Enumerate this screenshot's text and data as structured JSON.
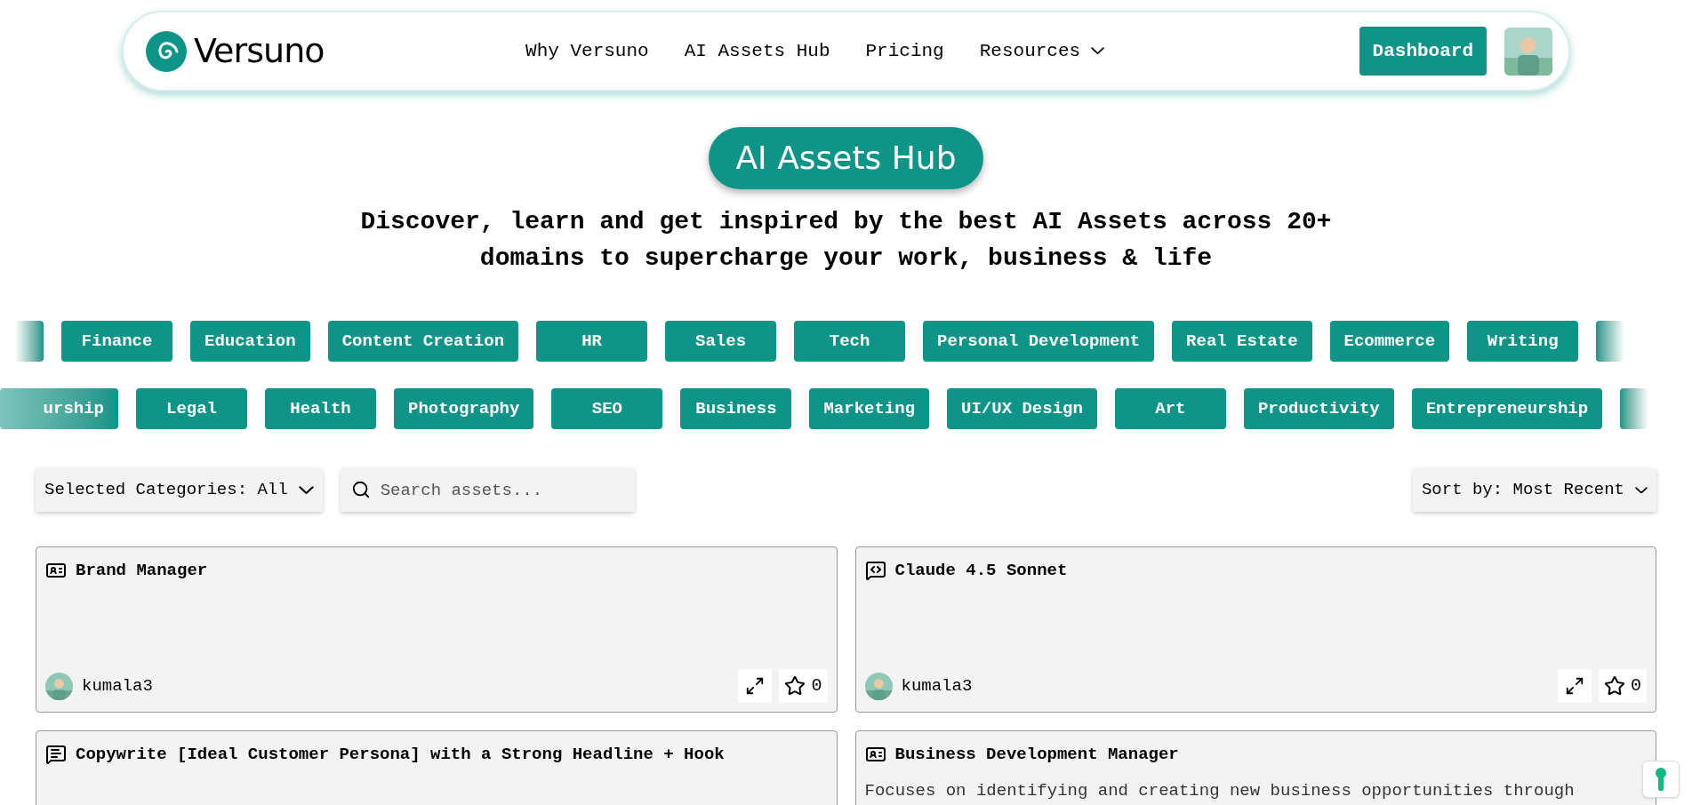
{
  "nav": {
    "brand": "Versuno",
    "links": [
      {
        "label": "Why Versuno",
        "kind": "link"
      },
      {
        "label": "AI Assets Hub",
        "kind": "link"
      },
      {
        "label": "Pricing",
        "kind": "link"
      },
      {
        "label": "Resources",
        "kind": "dropdown"
      }
    ],
    "cta": "Dashboard"
  },
  "hero": {
    "badge": "AI Assets Hub",
    "lines": [
      "Discover, learn and get inspired by the best AI Assets across 20+",
      "domains to supercharge your work, business & life"
    ]
  },
  "tag_rows": [
    [
      "",
      "Finance",
      "Education",
      "Content Creation",
      "HR",
      "Sales",
      "Tech",
      "Personal Development",
      "Real Estate",
      "Ecommerce",
      "Writing",
      ""
    ],
    [
      "urship",
      "Legal",
      "Health",
      "Photography",
      "SEO",
      "Business",
      "Marketing",
      "UI/UX Design",
      "Art",
      "Productivity",
      "Entrepreneurship",
      ""
    ]
  ],
  "filters": {
    "categories": "Selected Categories: All",
    "search_placeholder": "Search assets...",
    "sort": "Sort by: Most Recent"
  },
  "cards": [
    {
      "kind": "persona",
      "title": "Brand Manager",
      "author": "kumala3",
      "stars_count": "0"
    },
    {
      "kind": "model",
      "title": "Claude 4.5 Sonnet",
      "author": "kumala3",
      "stars_count": "0"
    },
    {
      "kind": "prompt",
      "title": "Copywrite [Ideal Customer Persona] with a Strong Headline + Hook"
    },
    {
      "kind": "persona",
      "title": "Business Development Manager",
      "description": "Focuses on identifying and creating new business opportunities through"
    }
  ]
}
